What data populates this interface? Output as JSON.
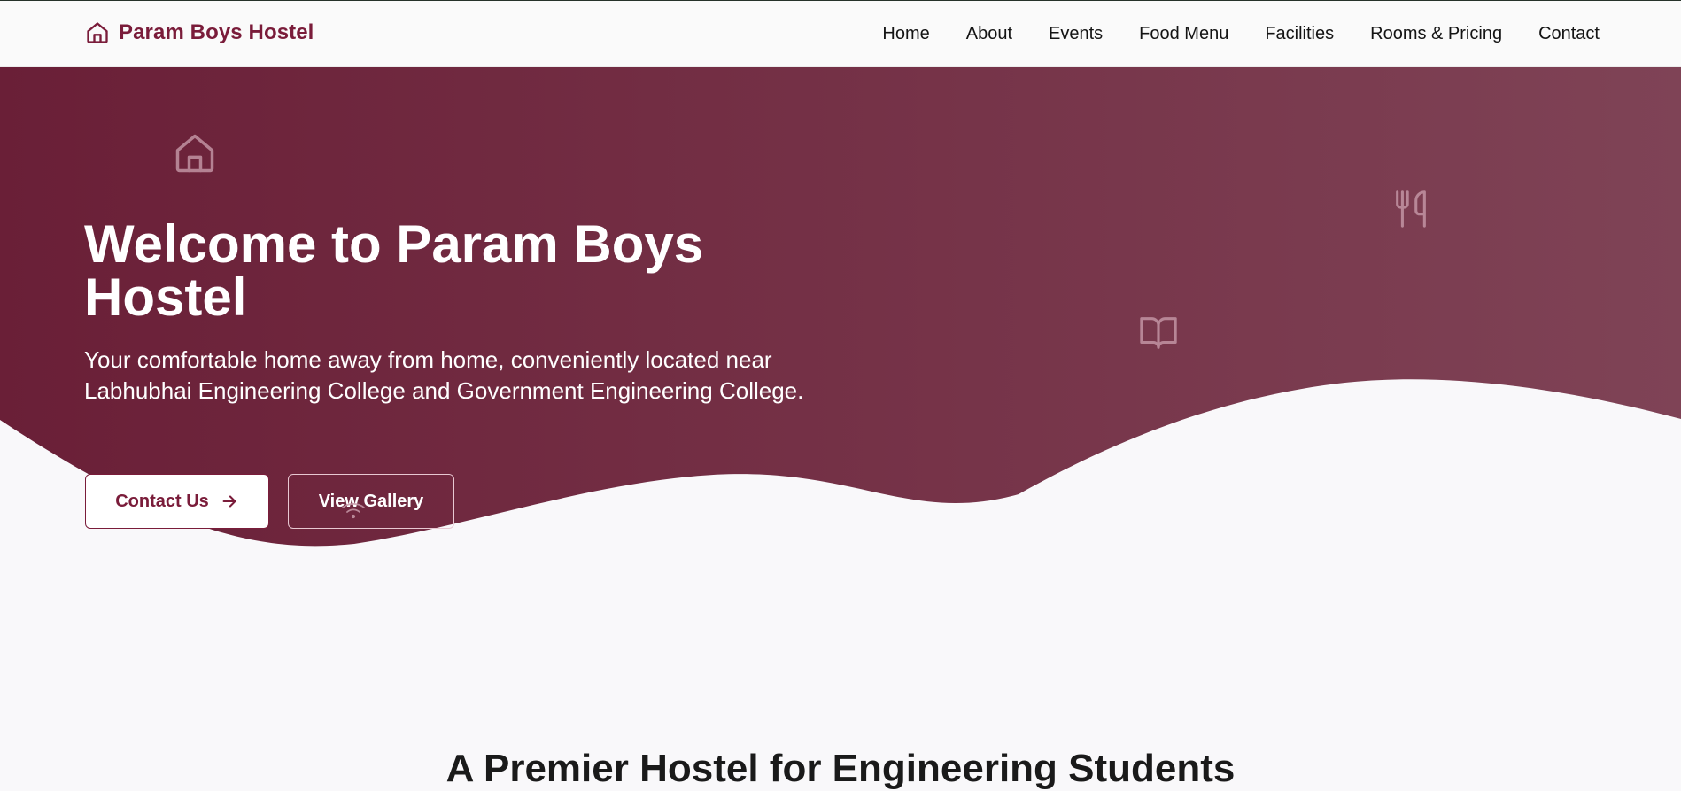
{
  "header": {
    "brand_icon": "home-icon",
    "brand_name": "Param Boys Hostel",
    "nav": [
      "Home",
      "About",
      "Events",
      "Food Menu",
      "Facilities",
      "Rooms & Pricing",
      "Contact"
    ]
  },
  "hero": {
    "title": "Welcome to Param Boys Hostel",
    "subtitle": "Your comfortable home away from home, conveniently located near Labhubhai Engineering College and Government Engineering College.",
    "contact_button": "Contact Us",
    "contact_button_icon": "arrow-right-icon",
    "gallery_button": "View Gallery",
    "decorative_icons": [
      "home-icon",
      "utensils-icon",
      "book-icon",
      "wifi-icon"
    ]
  },
  "section": {
    "heading": "A Premier Hostel for Engineering Students"
  },
  "colors": {
    "brand": "#7a1c3a",
    "hero_gradient_start": "#6a1f37",
    "hero_gradient_end": "#7f4356",
    "page_bg": "#f9f8fa"
  }
}
